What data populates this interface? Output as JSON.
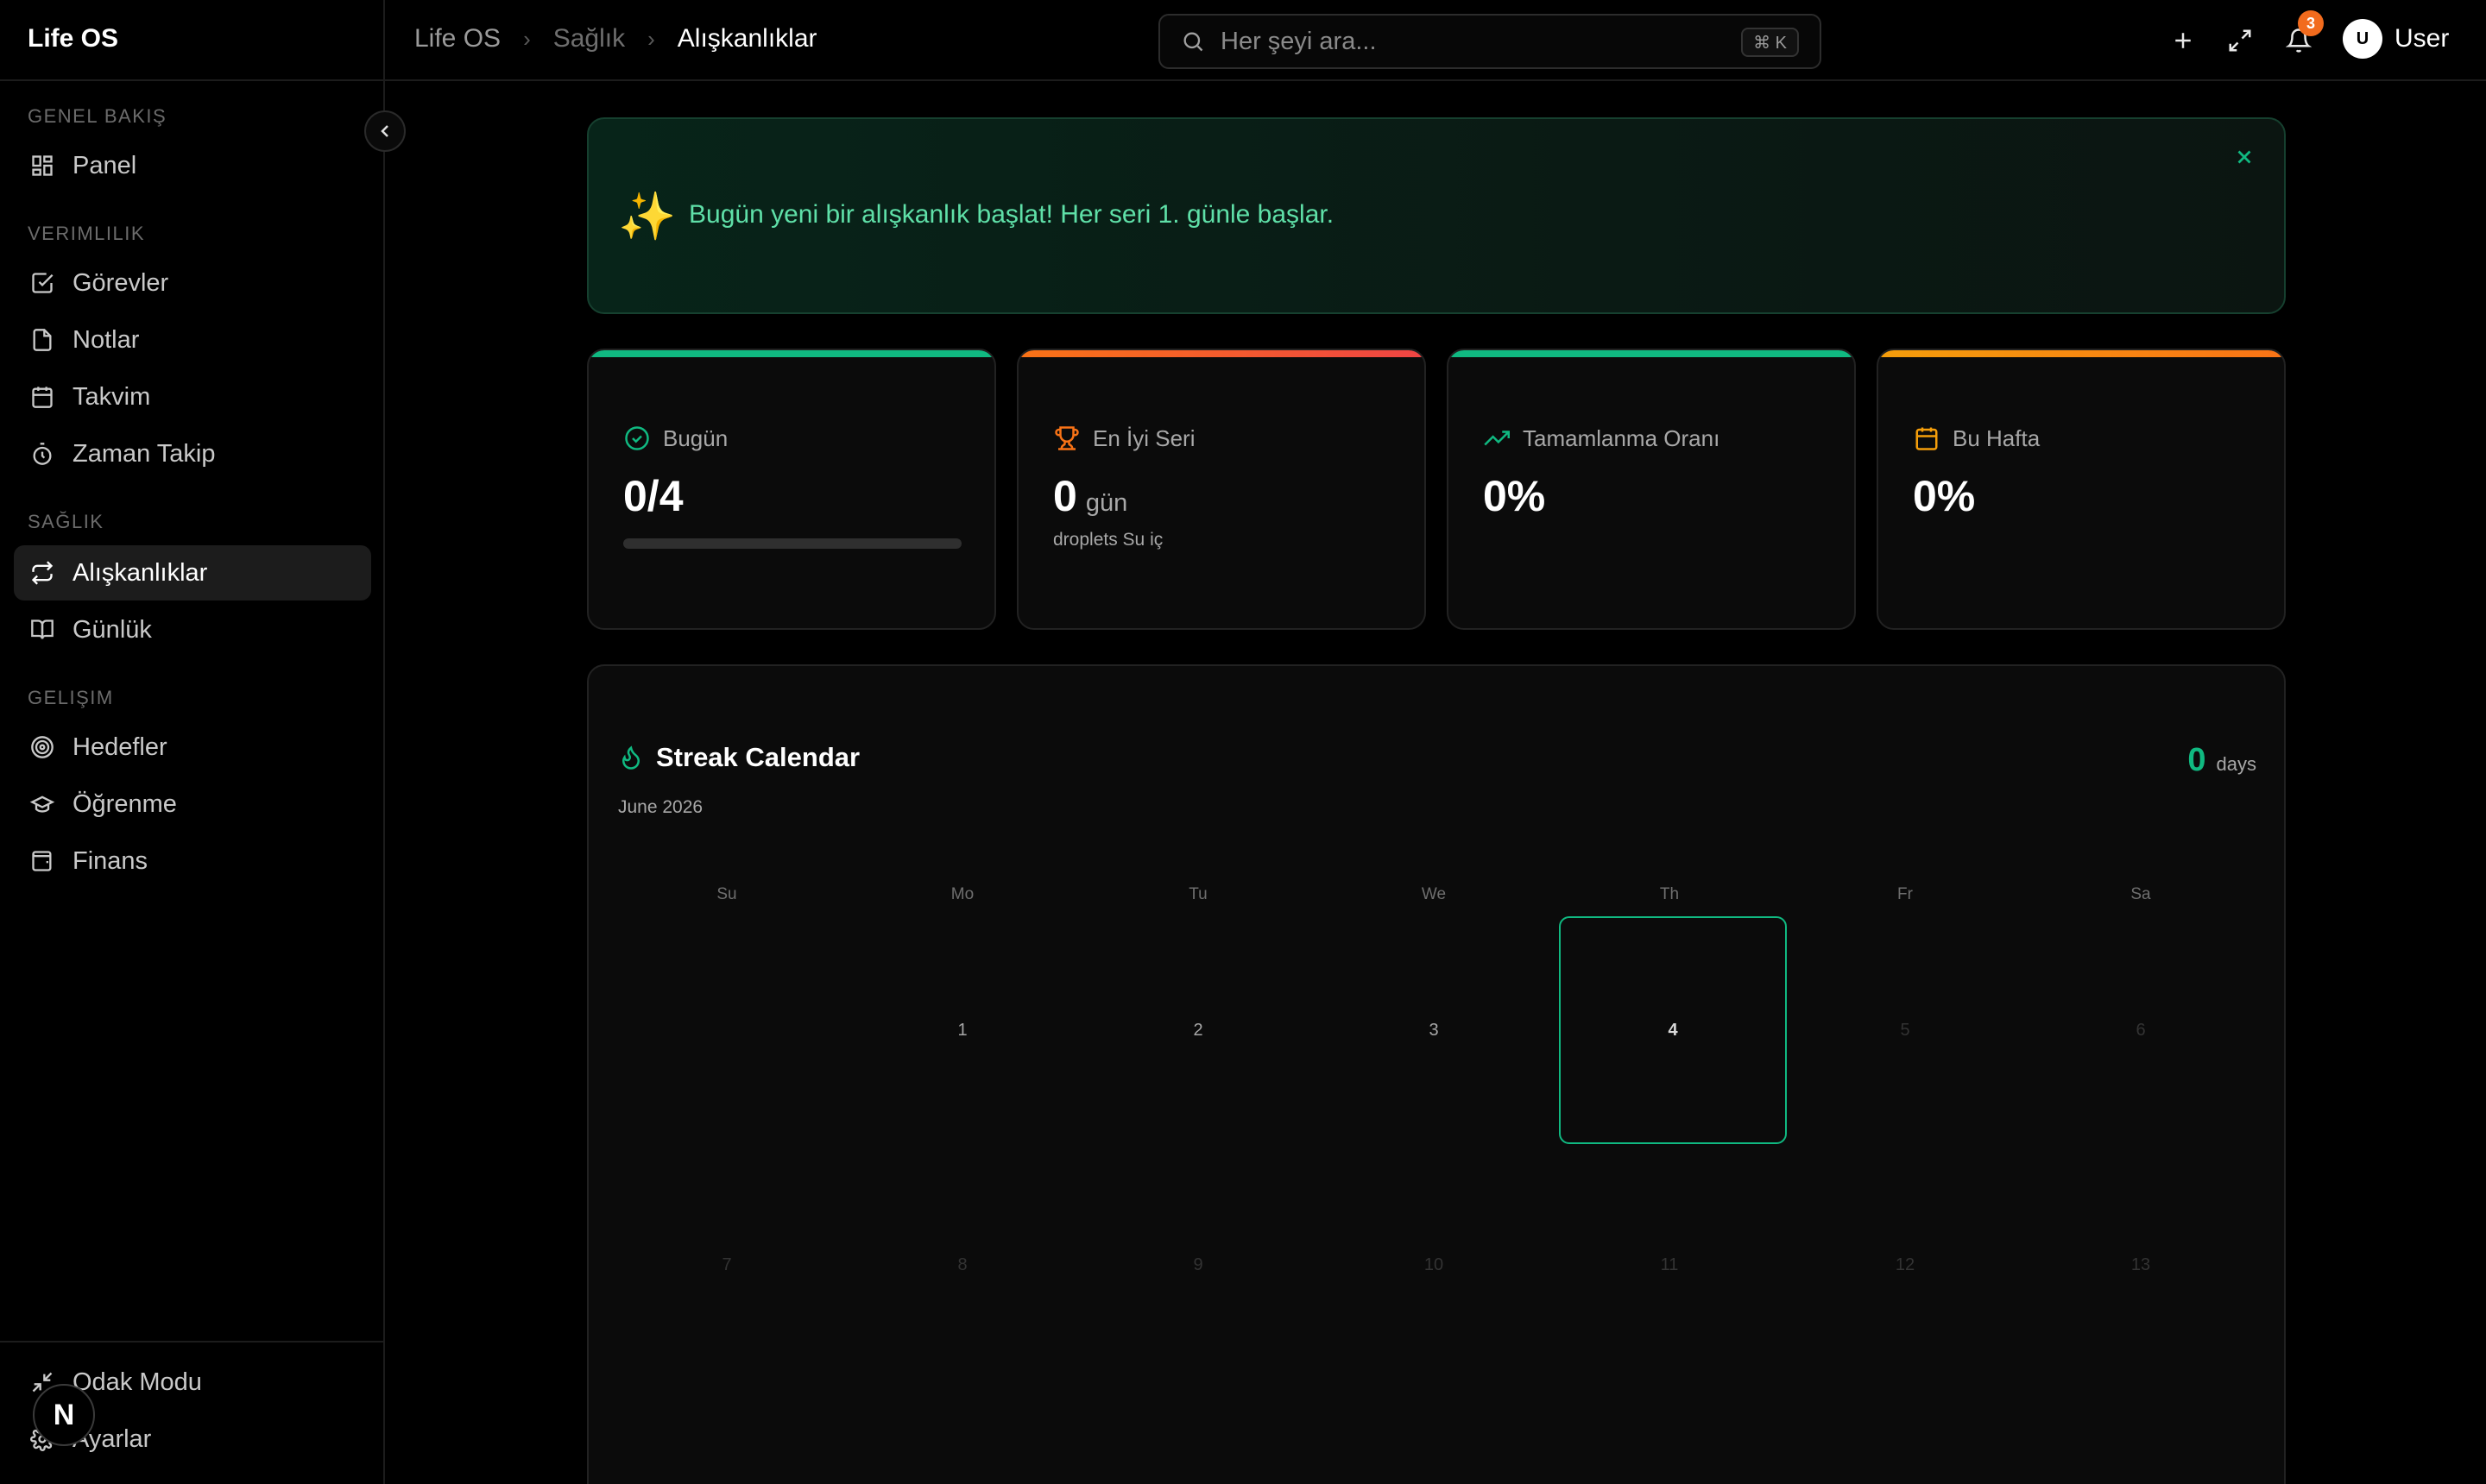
{
  "app": {
    "title": "Life OS"
  },
  "sidebar": {
    "sections": [
      {
        "label": "GENEL BAKIŞ"
      },
      {
        "label": "VERIMLILIK"
      },
      {
        "label": "SAĞLIK"
      },
      {
        "label": "GELIŞIM"
      }
    ],
    "items": [
      {
        "label": "Panel",
        "icon": "layout-grid-icon"
      },
      {
        "label": "Görevler",
        "icon": "check-square-icon"
      },
      {
        "label": "Notlar",
        "icon": "file-icon"
      },
      {
        "label": "Takvim",
        "icon": "calendar-icon"
      },
      {
        "label": "Zaman Takip",
        "icon": "timer-icon"
      },
      {
        "label": "Alışkanlıklar",
        "icon": "repeat-icon",
        "active": true
      },
      {
        "label": "Günlük",
        "icon": "book-open-icon"
      },
      {
        "label": "Hedefler",
        "icon": "target-icon"
      },
      {
        "label": "Öğrenme",
        "icon": "graduation-cap-icon"
      },
      {
        "label": "Finans",
        "icon": "wallet-icon"
      }
    ],
    "bottom_items": [
      {
        "label": "Odak Modu",
        "icon": "minimize-icon"
      },
      {
        "label": "Ayarlar",
        "icon": "settings-icon"
      }
    ],
    "floating_badge": "N"
  },
  "header": {
    "breadcrumbs": [
      "Life OS",
      "Sağlık",
      "Alışkanlıklar"
    ],
    "search": {
      "placeholder": "Her şeyi ara...",
      "shortcut": "⌘ K"
    },
    "notifications_count": "3",
    "user": {
      "initial": "U",
      "name": "User"
    }
  },
  "banner": {
    "icon": "sparkles-icon",
    "text": "Bugün yeni bir alışkanlık başlat! Her seri 1. günle başlar."
  },
  "stats": [
    {
      "label": "Bugün",
      "value": "0/4",
      "progress": 0,
      "accent": "#10b981",
      "icon": "check-circle-icon"
    },
    {
      "label": "En İyi Seri",
      "value": "0",
      "unit": "gün",
      "sub": "droplets Su iç",
      "accent": "#ef4444",
      "icon": "trophy-icon"
    },
    {
      "label": "Tamamlanma Oranı",
      "value": "0%",
      "accent": "#10b981",
      "icon": "trending-up-icon"
    },
    {
      "label": "Bu Hafta",
      "value": "0%",
      "accent": "#f59e0b",
      "icon": "calendar-icon"
    }
  ],
  "calendar": {
    "title": "Streak Calendar",
    "month": "June 2026",
    "streak_value": "0",
    "streak_unit": "days",
    "weekdays": [
      "Su",
      "Mo",
      "Tu",
      "We",
      "Th",
      "Fr",
      "Sa"
    ],
    "days": [
      "1",
      "2",
      "3",
      "4",
      "5",
      "6",
      "7",
      "8",
      "9",
      "10",
      "11",
      "12",
      "13"
    ],
    "today": "4"
  },
  "colors": {
    "accent_green": "#10b981",
    "accent_orange": "#f97316",
    "accent_red": "#ef4444",
    "accent_amber": "#f59e0b",
    "background": "#000000",
    "card": "#0b0b0b"
  }
}
